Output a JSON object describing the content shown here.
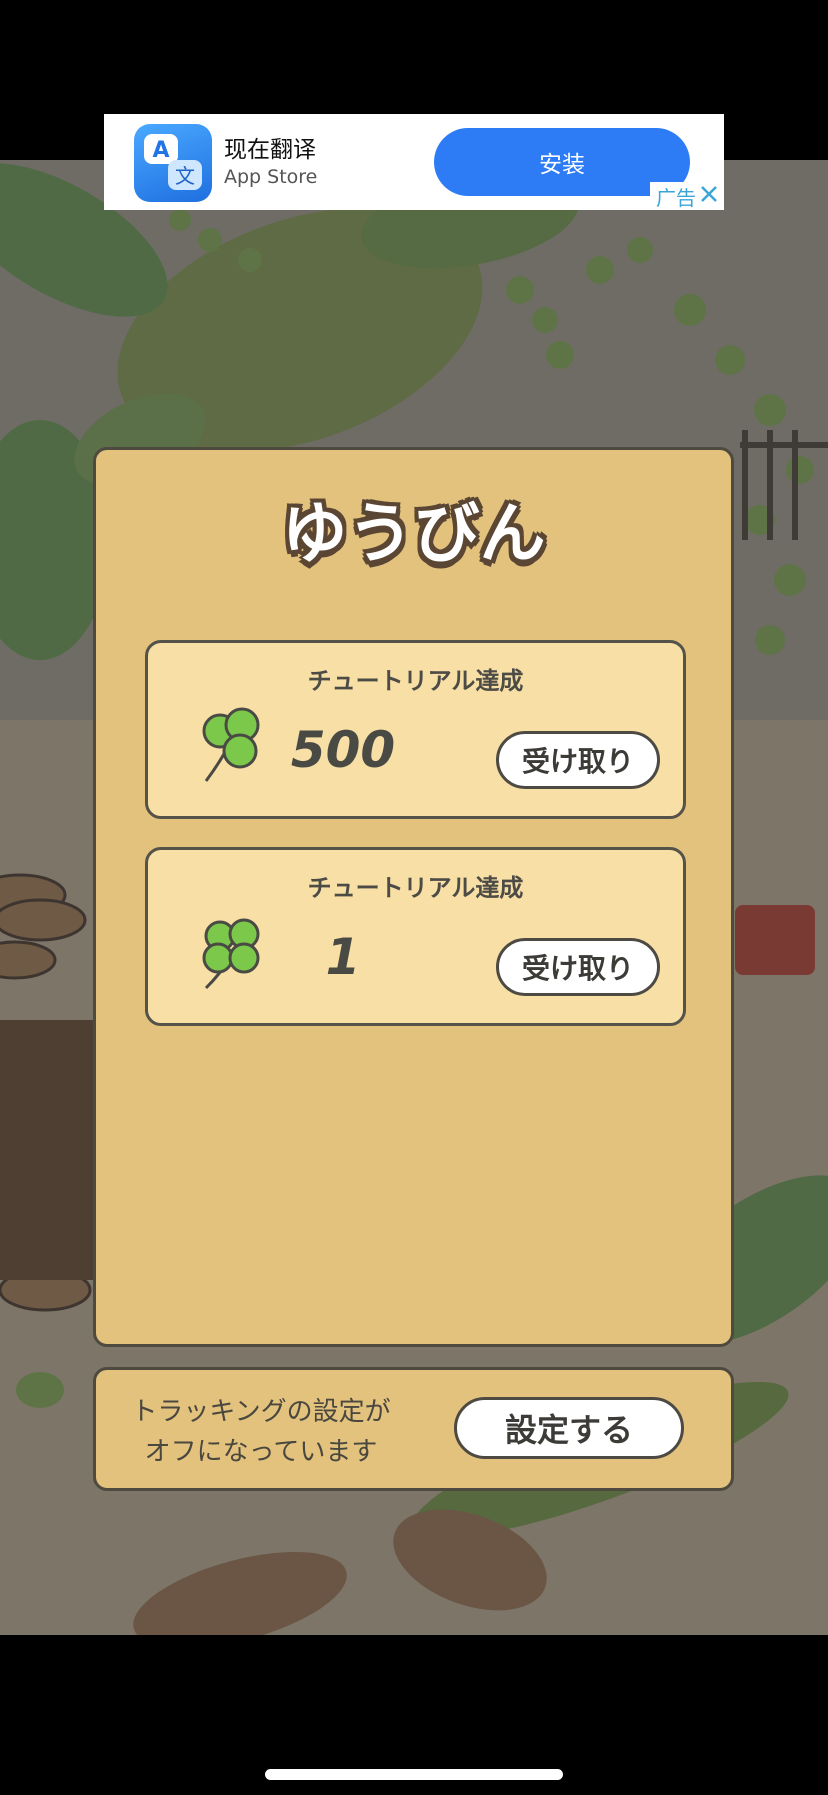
{
  "ad": {
    "title": "现在翻译",
    "subtitle": "App Store",
    "install_label": "安装",
    "tag_label": "广告",
    "close_icon": "close-icon",
    "app_icon": "translate-app-icon"
  },
  "mail": {
    "title": "ゆうびん",
    "rewards": [
      {
        "label": "チュートリアル達成",
        "amount": "500",
        "icon": "three-leaf-clover-icon",
        "claim_label": "受け取り"
      },
      {
        "label": "チュートリアル達成",
        "amount": "1",
        "icon": "four-leaf-clover-icon",
        "claim_label": "受け取り"
      }
    ]
  },
  "tracking": {
    "line1": "トラッキングの設定が",
    "line2": "オフになっています",
    "button_label": "設定する"
  },
  "colors": {
    "panel": "#e2c27d",
    "card": "#f7dfa6",
    "outline": "#4f4a40",
    "clover": "#7cc84a",
    "ad_button": "#2d7cf6"
  }
}
